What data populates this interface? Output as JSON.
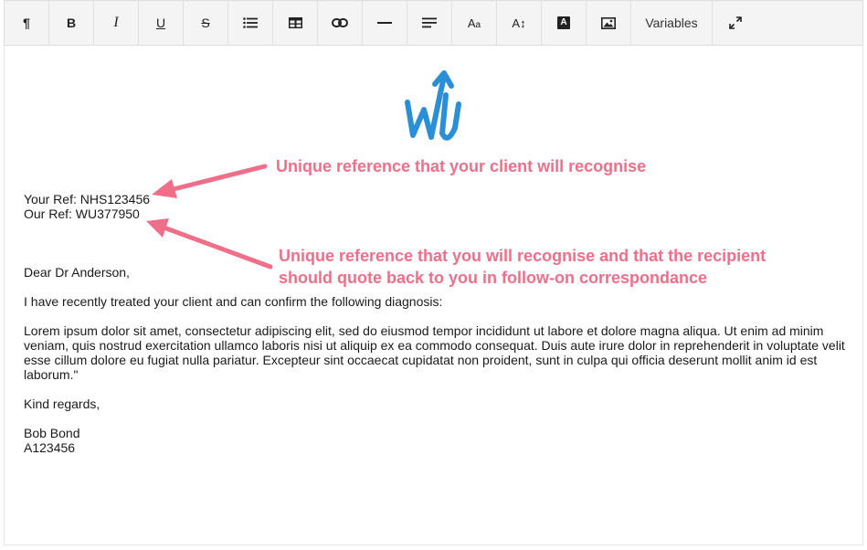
{
  "toolbar": {
    "variables_label": "Variables",
    "buttons": [
      "paragraph-icon",
      "bold-icon",
      "italic-icon",
      "underline-icon",
      "strikethrough-icon",
      "list-icon",
      "table-icon",
      "link-icon",
      "horizontal-rule-icon",
      "align-icon",
      "font-size-icon",
      "line-height-icon",
      "text-color-icon",
      "image-icon",
      "variables",
      "fullscreen-icon"
    ]
  },
  "logo": {
    "text": "WU",
    "color": "#2a8fd4"
  },
  "letter": {
    "your_ref": "Your Ref: NHS123456",
    "our_ref": "Our Ref: WU377950",
    "salutation": "Dear Dr Anderson,",
    "intro": "I have recently treated your client and can confirm the following diagnosis:",
    "body": "Lorem ipsum dolor sit amet, consectetur adipiscing elit, sed do eiusmod tempor incididunt ut labore et dolore magna aliqua. Ut enim ad minim veniam, quis nostrud exercitation ullamco laboris nisi ut aliquip ex ea commodo consequat. Duis aute irure dolor in reprehenderit in voluptate velit esse cillum dolore eu fugiat nulla pariatur. Excepteur sint occaecat cupidatat non proident, sunt in culpa qui officia deserunt mollit anim id est laborum.\"",
    "closing": "Kind regards,",
    "name": "Bob Bond",
    "id": "A123456"
  },
  "annotations": {
    "your_ref_note": "Unique reference that your client will recognise",
    "our_ref_note_line1": "Unique reference that you will recognise and that the recipient",
    "our_ref_note_line2": "should quote back to you in follow-on correspondance",
    "color": "#ef6f8a"
  }
}
